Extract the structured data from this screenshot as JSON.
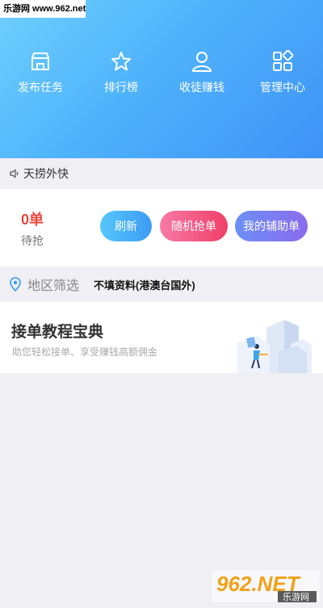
{
  "watermark_top": "乐游网 www.962.net",
  "nav": [
    {
      "label": "发布任务",
      "icon": "shop-icon"
    },
    {
      "label": "排行榜",
      "icon": "star-icon"
    },
    {
      "label": "收徒赚钱",
      "icon": "user-icon"
    },
    {
      "label": "管理中心",
      "icon": "apps-icon"
    }
  ],
  "notice": {
    "text": "天捞外快",
    "icon": "speaker-icon"
  },
  "orders": {
    "count": "0单",
    "count_label": "待抢",
    "refresh_label": "刷新",
    "grab_label": "随机抢单",
    "mine_label": "我的辅助单"
  },
  "region": {
    "label": "地区筛选",
    "value": "不填资料(港澳台国外)",
    "icon": "location-icon"
  },
  "tutorial": {
    "title": "接单教程宝典",
    "subtitle": "助您轻松接单、享受赚钱高额佣金"
  },
  "watermark_bottom": {
    "logo": "962.NET",
    "text": "乐游网"
  },
  "colors": {
    "header_start": "#6fd0fd",
    "header_end": "#3f92f7",
    "count": "#e8483c"
  }
}
